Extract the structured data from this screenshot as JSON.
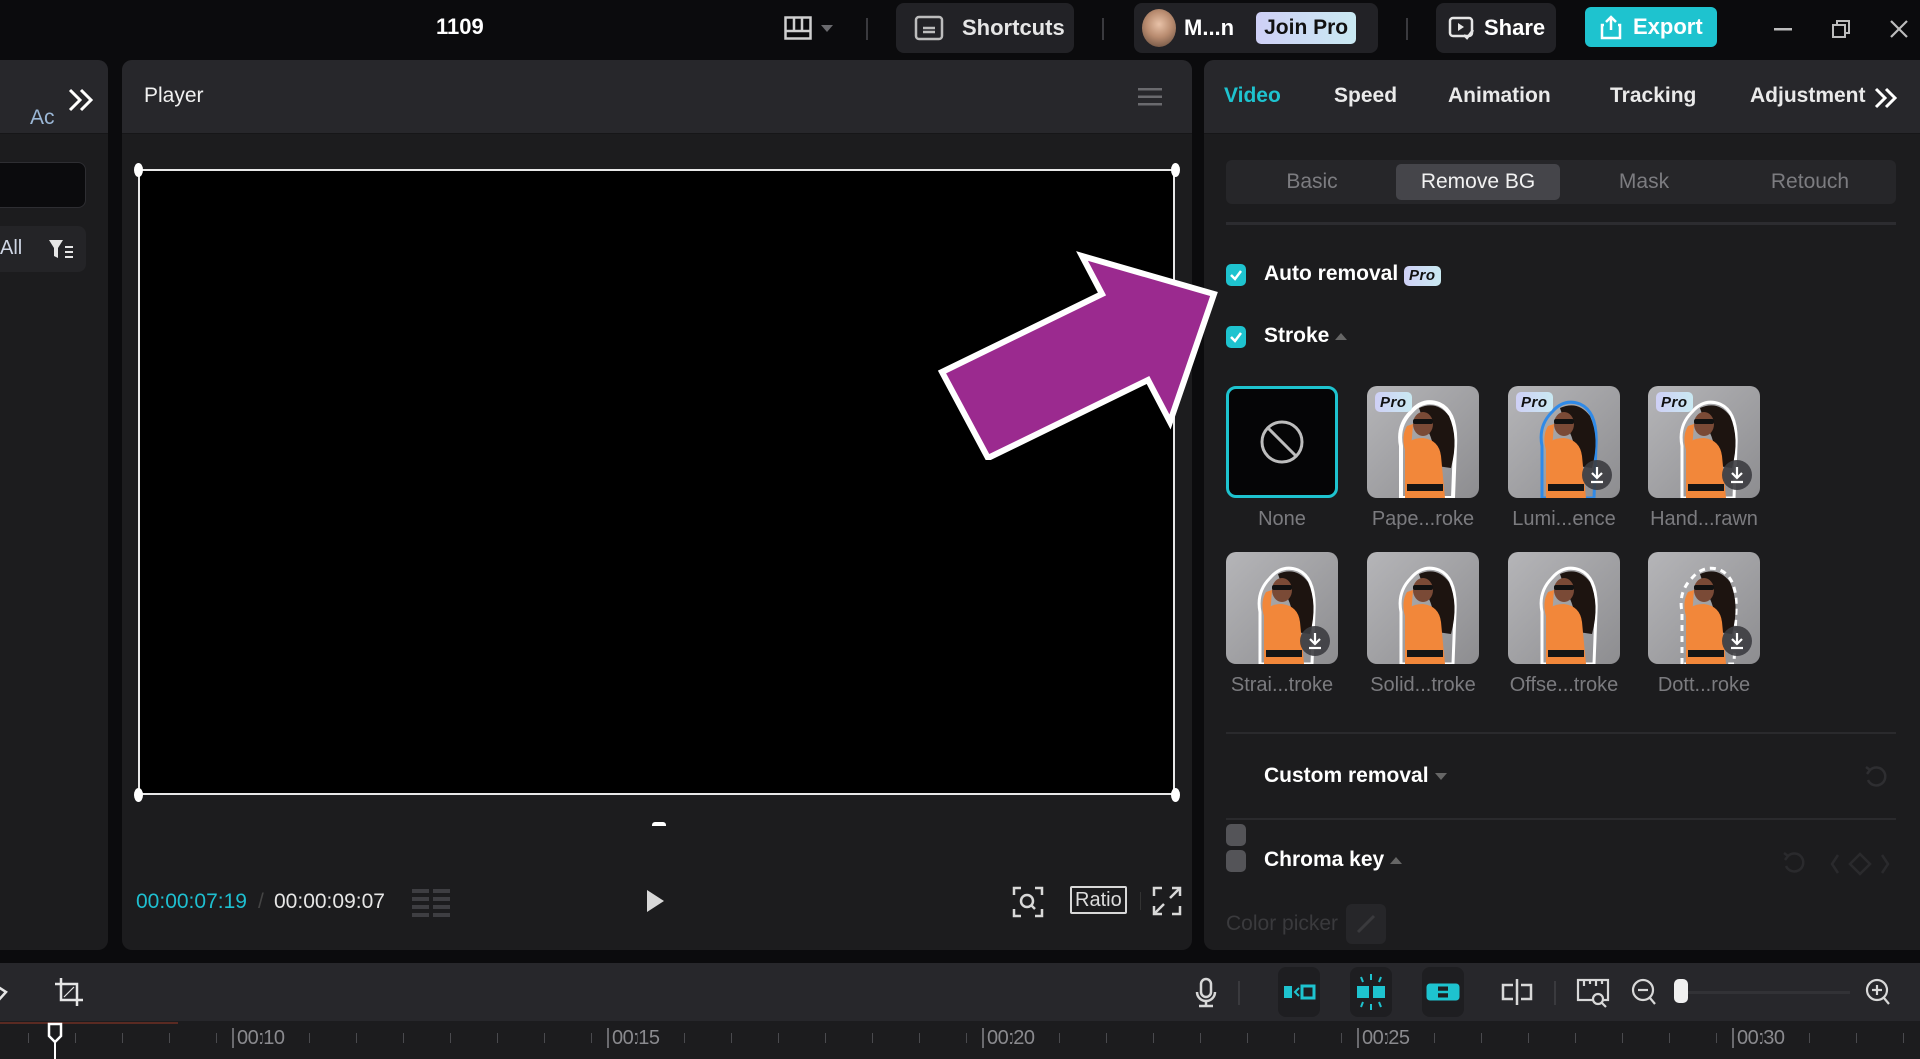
{
  "topbar": {
    "project_title": "1109",
    "shortcuts_label": "Shortcuts",
    "user_name": "M...n",
    "join_pro_label": "Join Pro",
    "share_label": "Share",
    "export_label": "Export",
    "accent_color": "#1ec3cf"
  },
  "left_panel": {
    "tab_label": "Ac",
    "search_placeholder": "",
    "filter_label": "All"
  },
  "player": {
    "title": "Player",
    "current_time": "00:00:07:19",
    "separator": "/",
    "total_time": "00:00:09:07",
    "ratio_label": "Ratio"
  },
  "right_panel": {
    "tabs": [
      {
        "label": "Video",
        "active": true
      },
      {
        "label": "Speed",
        "active": false
      },
      {
        "label": "Animation",
        "active": false
      },
      {
        "label": "Tracking",
        "active": false
      },
      {
        "label": "Adjustment",
        "active": false
      }
    ],
    "subtabs": [
      {
        "label": "Basic",
        "active": false
      },
      {
        "label": "Remove BG",
        "active": true
      },
      {
        "label": "Mask",
        "active": false
      },
      {
        "label": "Retouch",
        "active": false
      }
    ],
    "auto_removal": {
      "label": "Auto removal",
      "checked": true,
      "badge": "Pro"
    },
    "stroke": {
      "label": "Stroke",
      "checked": true,
      "items": [
        {
          "name": "None",
          "selected": true,
          "pro": false,
          "download": false,
          "style": "none"
        },
        {
          "name": "Pape...roke",
          "selected": false,
          "pro": true,
          "download": false,
          "style": "paper"
        },
        {
          "name": "Lumi...ence",
          "selected": false,
          "pro": true,
          "download": true,
          "style": "luminescence"
        },
        {
          "name": "Hand...rawn",
          "selected": false,
          "pro": true,
          "download": true,
          "style": "handdrawn"
        },
        {
          "name": "Strai...troke",
          "selected": false,
          "pro": false,
          "download": true,
          "style": "straight"
        },
        {
          "name": "Solid...troke",
          "selected": false,
          "pro": false,
          "download": false,
          "style": "solid"
        },
        {
          "name": "Offse...troke",
          "selected": false,
          "pro": false,
          "download": false,
          "style": "offset"
        },
        {
          "name": "Dott...roke",
          "selected": false,
          "pro": false,
          "download": true,
          "style": "dotted"
        }
      ],
      "pro_badge": "Pro"
    },
    "custom_removal": {
      "label": "Custom removal",
      "checked": false
    },
    "chroma_key": {
      "label": "Chroma key",
      "checked": false,
      "color_picker_label": "Color picker"
    }
  },
  "timeline": {
    "ruler_labels": [
      "00:10",
      "00:15",
      "00:20",
      "00:25",
      "00:30"
    ],
    "zoom_level": 0.0
  },
  "annotation": {
    "arrow_color": "#9b2a8f",
    "arrow_outline": "#ffffff",
    "target": "Auto removal"
  }
}
